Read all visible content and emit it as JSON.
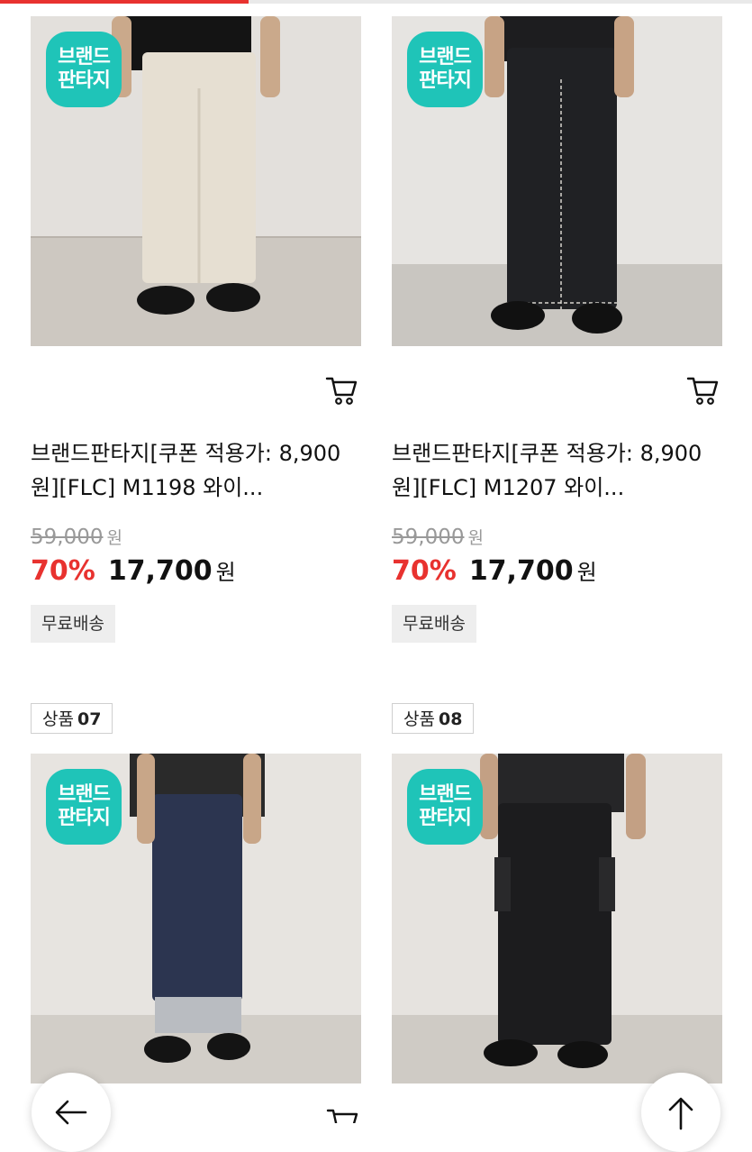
{
  "scroll_progress_percent": 33,
  "colors": {
    "accent": "#e8322f",
    "brand": "#1fc4b8",
    "badge_bg": "#eeeeee"
  },
  "products": [
    {
      "rank_prefix": "",
      "rank_number": "",
      "logo_lines": [
        "브랜드",
        "판타지"
      ],
      "title": "브랜드판타지[쿠폰 적용가: 8,900원][FLC] M1198 와이...",
      "original_price": "59,000",
      "currency": "원",
      "discount": "70%",
      "price": "17,700",
      "shipping": "무료배송",
      "pants_color": "#e6dfd2"
    },
    {
      "rank_prefix": "",
      "rank_number": "",
      "logo_lines": [
        "브랜드",
        "판타지"
      ],
      "title": "브랜드판타지[쿠폰 적용가: 8,900원][FLC] M1207 와이...",
      "original_price": "59,000",
      "currency": "원",
      "discount": "70%",
      "price": "17,700",
      "shipping": "무료배송",
      "pants_color": "#202124"
    },
    {
      "rank_prefix": "상품",
      "rank_number": "07",
      "logo_lines": [
        "브랜드",
        "판타지"
      ],
      "pants_color": "#2c3550"
    },
    {
      "rank_prefix": "상품",
      "rank_number": "08",
      "logo_lines": [
        "브랜드",
        "판타지"
      ],
      "pants_color": "#1c1c1e"
    }
  ],
  "icons": {
    "cart": "cart-icon",
    "back": "arrow-left-icon",
    "top": "arrow-up-icon"
  }
}
